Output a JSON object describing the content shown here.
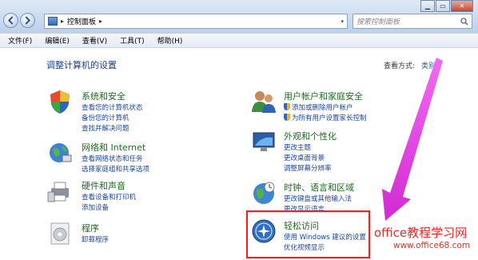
{
  "window": {
    "breadcrumb": "控制面板",
    "search_placeholder": "搜索控制面板"
  },
  "menu": [
    "文件(F)",
    "编辑(E)",
    "查看(V)",
    "工具(T)",
    "帮助(H)"
  ],
  "page": {
    "title": "调整计算机的设置",
    "view_by_label": "查看方式:",
    "view_by_value": "类别"
  },
  "categories": [
    {
      "title": "系统和安全",
      "links": [
        "查看您的计算机状态",
        "备份您的计算机",
        "查找并解决问题"
      ]
    },
    {
      "title": "网络和 Internet",
      "links": [
        "查看网络状态和任务",
        "选择家庭组和共享选项"
      ]
    },
    {
      "title": "硬件和声音",
      "links": [
        "查看设备和打印机",
        "添加设备"
      ]
    },
    {
      "title": "程序",
      "links": [
        "卸载程序"
      ]
    },
    {
      "title": "用户帐户和家庭安全",
      "links": [
        "添加或删除用户帐户",
        "为所有用户设置家长控制"
      ]
    },
    {
      "title": "外观和个性化",
      "links": [
        "更改主题",
        "更改桌面背景",
        "调整屏幕分辨率"
      ]
    },
    {
      "title": "时钟、语言和区域",
      "links": [
        "更改键盘或其他输入法",
        "更改显示语言"
      ]
    },
    {
      "title": "轻松访问",
      "links": [
        "使用 Windows 建议的设置",
        "优化视频显示"
      ]
    }
  ],
  "watermark": {
    "line1": "office教程学习网",
    "line2": "www.office68.com"
  },
  "colors": {
    "heading_green": "#1e6a1e",
    "link_blue": "#1a46a8",
    "highlight_red": "#ff1a1a",
    "arrow_magenta": "#e62ee6"
  }
}
